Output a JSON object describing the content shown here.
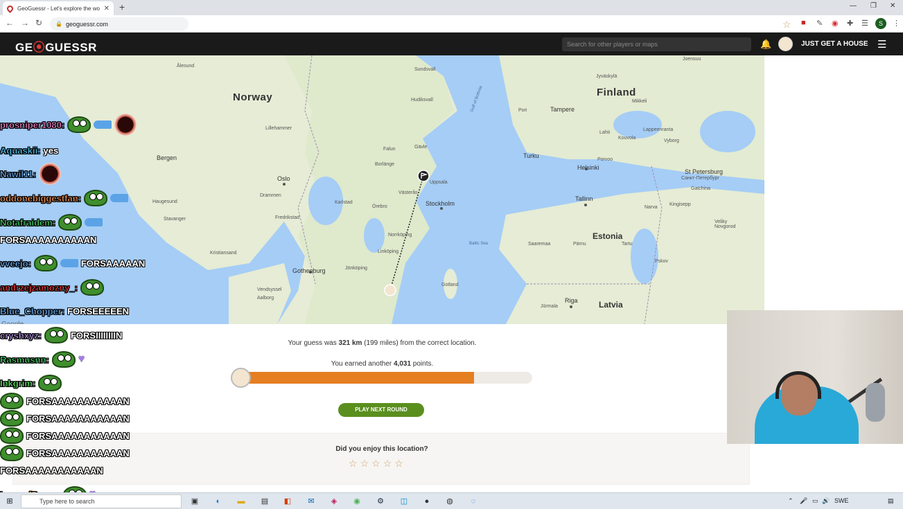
{
  "browser": {
    "tab_title": "GeoGuessr - Let's explore the wo",
    "tab_close": "✕",
    "new_tab": "+",
    "url": "geoguessr.com",
    "profile_initial": "S"
  },
  "header": {
    "logo_left": "GE",
    "logo_pin": "⦿",
    "logo_right": "GUESSR",
    "search_placeholder": "Search for other players or maps",
    "username": "JUST GET A HOUSE"
  },
  "map": {
    "labels": {
      "norway": "Norway",
      "finland": "Finland",
      "estonia": "Estonia",
      "latvia": "Latvia",
      "bergen": "Bergen",
      "oslo": "Oslo",
      "stockholm": "Stockholm",
      "gothenburg": "Gothenburg",
      "turku": "Turku",
      "helsinki": "Helsinki",
      "tallinn": "Tallinn",
      "tampere": "Tampere",
      "st_petersburg": "St Petersburg",
      "st_petersburg_ru": "Санкт-Петербург",
      "riga": "Riga",
      "trondheim": "Ålesund",
      "sundsvall": "Sundsvall",
      "uppsala": "Uppsala",
      "vasteras": "Västerås",
      "orebro": "Örebro",
      "norrkoping": "Norrköping",
      "linkoping": "Linköping",
      "jonkoping": "Jönköping",
      "drammen": "Drammen",
      "stavanger": "Stavanger",
      "kristiansand": "Kristiansand",
      "haugesund": "Haugesund",
      "aalborg": "Aalborg",
      "vendsyssel": "Vendsyssel",
      "falun": "Falun",
      "gavle": "Gävle",
      "borlange": "Borlänge",
      "karlstad": "Karlstad",
      "lillehammer": "Lillehammer",
      "fredrikstad": "Fredrikstad",
      "gotland": "Gotland",
      "baltic_sea": "Baltic Sea",
      "gulf_bothnia": "Gulf of Bothnia",
      "jyvaskyla": "Jyväskylä",
      "joensuu": "Joensuu",
      "mikkeli": "Mikkeli",
      "pori": "Pori",
      "lahti": "Lahti",
      "kouvola": "Kouvola",
      "lappeenranta": "Lappeenranta",
      "vyborg": "Vyborg",
      "porvoo": "Porvoo",
      "narva": "Narva",
      "kingisepp": "Kingisepp",
      "gatchina": "Gatchina",
      "pskov": "Pskov",
      "tartu": "Tartu",
      "parnu": "Pärnu",
      "saaremaa": "Saaremaa",
      "velikiy": "Veliky\nNovgorod",
      "jurmala": "Jūrmala",
      "hudiksvall": "Hudiksvall"
    },
    "google_mark": "Google"
  },
  "result": {
    "guess_prefix": "Your guess was ",
    "distance": "321 km",
    "guess_suffix": " (199 miles) from the correct location.",
    "points_prefix": "You earned another ",
    "points": "4,031",
    "points_suffix": " points.",
    "score_fraction": 0.806,
    "next_button": "PLAY NEXT ROUND",
    "enjoy_title": "Did you enjoy this location?",
    "rating_stars": 5
  },
  "chat": [
    {
      "user": "prosniper1080:",
      "color": "#ff8fd8",
      "msg": "",
      "emotes": [
        "frog",
        "drop",
        "cup"
      ]
    },
    {
      "user": "Aquaskii:",
      "color": "#58d1ff",
      "msg": "yes",
      "emotes": []
    },
    {
      "user": "Nawil11:",
      "color": "#6fb7ff",
      "msg": "",
      "emotes": [
        "cup"
      ]
    },
    {
      "user": "oddonebiggestfan:",
      "color": "#ff9b5a",
      "msg": "",
      "emotes": [
        "frog",
        "drop"
      ]
    },
    {
      "user": "Notafraidem:",
      "color": "#4bd96f",
      "msg": "",
      "emotes": [
        "frog",
        "drop"
      ]
    },
    {
      "user": "",
      "color": "#fff",
      "msg": "FORSAAAAAAAAAAN",
      "emotes": []
    },
    {
      "user": "vveejo:",
      "color": "#6fb7ff",
      "msg": "FORSAAAAAN",
      "emotes": [
        "frog",
        "drop"
      ]
    },
    {
      "user": "andrzejzamozny_:",
      "color": "#ff4040",
      "msg": "",
      "emotes": [
        "frog"
      ]
    },
    {
      "user": "Blue_Chopper:",
      "color": "#6fb7ff",
      "msg": "FORSEEEEEN",
      "emotes": []
    },
    {
      "user": "cryshxyz:",
      "color": "#c7a3ff",
      "msg": "FORSIIIIIIIIN",
      "emotes": [
        "frog"
      ]
    },
    {
      "user": "Rasmusnn:",
      "color": "#4bd96f",
      "msg": "",
      "emotes": [
        "frog",
        "heart"
      ]
    },
    {
      "user": "Inkgrim:",
      "color": "#62ff6c",
      "msg": "",
      "emotes": [
        "frog"
      ]
    },
    {
      "user": "",
      "color": "#fff",
      "msg": "FORSAAAAAAAAAAAN",
      "emotes": [
        "frog"
      ]
    },
    {
      "user": "",
      "color": "#fff",
      "msg": "FORSAAAAAAAAAAAN",
      "emotes": [
        "frog"
      ]
    },
    {
      "user": "",
      "color": "#fff",
      "msg": "FORSAAAAAAAAAAAN",
      "emotes": [
        "frog"
      ]
    },
    {
      "user": "",
      "color": "#fff",
      "msg": "FORSAAAAAAAAAAAN",
      "emotes": [
        "frog"
      ]
    },
    {
      "user": "",
      "color": "#fff",
      "msg": "FORSAAAAAAAAAAAN",
      "emotes": []
    },
    {
      "user": "LawnofDoom:",
      "color": "#ffb347",
      "msg": "",
      "emotes": [
        "frog",
        "heart"
      ]
    }
  ],
  "taskbar": {
    "search_placeholder": "Type here to search",
    "lang": "SWE"
  },
  "colors": {
    "progress": "#e67e22",
    "button": "#5a8f1e",
    "header_bg": "#1a1a1a",
    "water": "#a5cdf6",
    "land": "#e8ecd6"
  }
}
